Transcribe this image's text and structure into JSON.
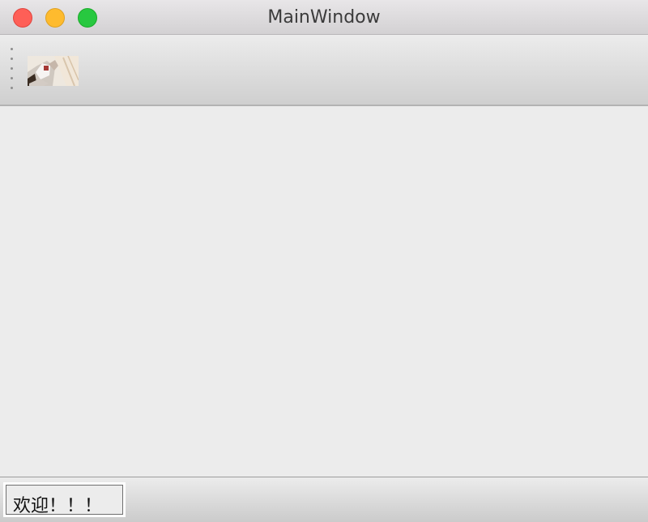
{
  "window": {
    "title": "MainWindow"
  },
  "traffic_lights": [
    {
      "name": "close-button",
      "color": "#fe5f57"
    },
    {
      "name": "minimize-button",
      "color": "#febb2e"
    },
    {
      "name": "zoom-button",
      "color": "#28c840"
    }
  ],
  "toolbar": {
    "items": [
      {
        "icon": "image-thumbnail-icon"
      }
    ]
  },
  "statusbar": {
    "message": "欢迎！！！"
  }
}
